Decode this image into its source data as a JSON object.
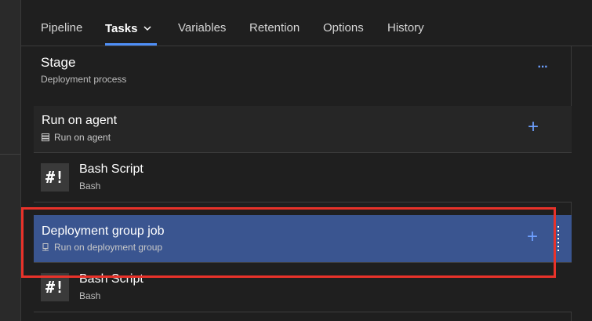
{
  "tabs": [
    {
      "label": "Pipeline"
    },
    {
      "label": "Tasks"
    },
    {
      "label": "Variables"
    },
    {
      "label": "Retention"
    },
    {
      "label": "Options"
    },
    {
      "label": "History"
    }
  ],
  "stage": {
    "title": "Stage",
    "subtitle": "Deployment process"
  },
  "jobs": [
    {
      "title": "Run on agent",
      "subtitle": "Run on agent",
      "tasks": [
        {
          "icon_text": "#!",
          "title": "Bash Script",
          "subtitle": "Bash"
        }
      ]
    },
    {
      "title": "Deployment group job",
      "subtitle": "Run on deployment group",
      "selected": true,
      "tasks": [
        {
          "icon_text": "#!",
          "title": "Bash Script",
          "subtitle": "Bash"
        }
      ]
    }
  ],
  "colors": {
    "accent": "#4f8ff7",
    "selected_row": "#3a5590",
    "highlight": "#e8322a"
  }
}
